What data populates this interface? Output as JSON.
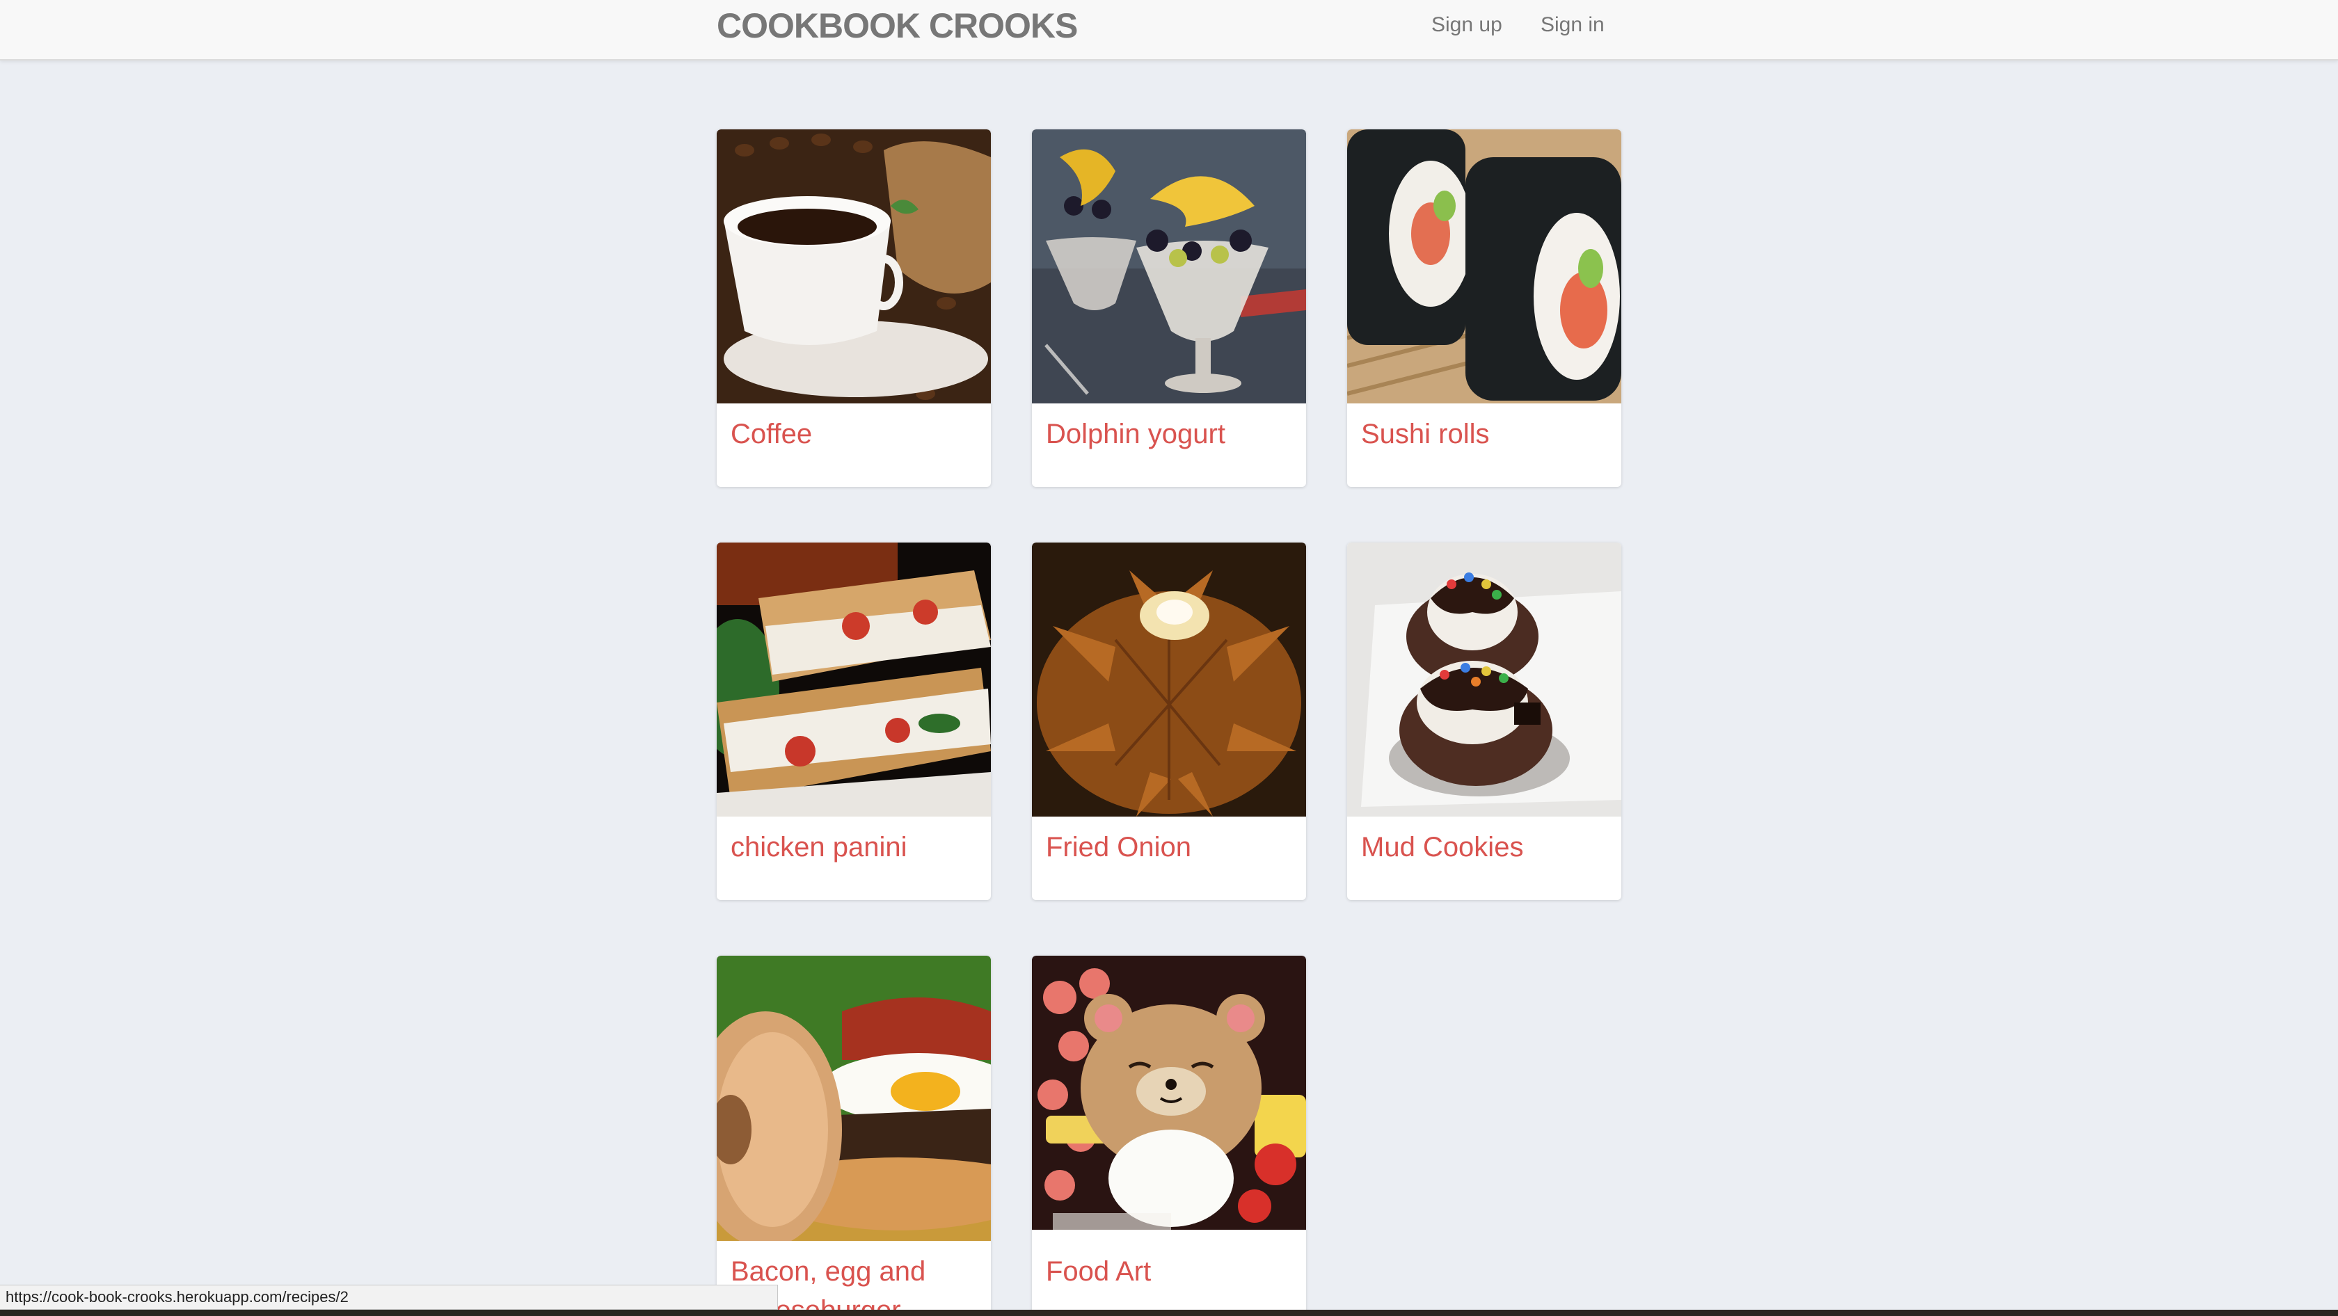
{
  "header": {
    "brand": "COOKBOOK CROOKS",
    "signup_label": "Sign up",
    "signin_label": "Sign in"
  },
  "recipes": [
    {
      "title": "Coffee",
      "image": "coffee-photo"
    },
    {
      "title": "Dolphin yogurt",
      "image": "dolphin-yogurt-photo"
    },
    {
      "title": "Sushi rolls",
      "image": "sushi-rolls-photo"
    },
    {
      "title": "chicken panini",
      "image": "chicken-panini-photo"
    },
    {
      "title": "Fried Onion",
      "image": "fried-onion-photo"
    },
    {
      "title": "Mud Cookies",
      "image": "mud-cookies-photo"
    },
    {
      "title": "Bacon, egg and cheeseburger",
      "image": "bacon-egg-burger-photo"
    },
    {
      "title": "Food Art",
      "image": "food-art-photo"
    }
  ],
  "status_bar": {
    "url": "https://cook-book-crooks.herokuapp.com/recipes/2"
  }
}
